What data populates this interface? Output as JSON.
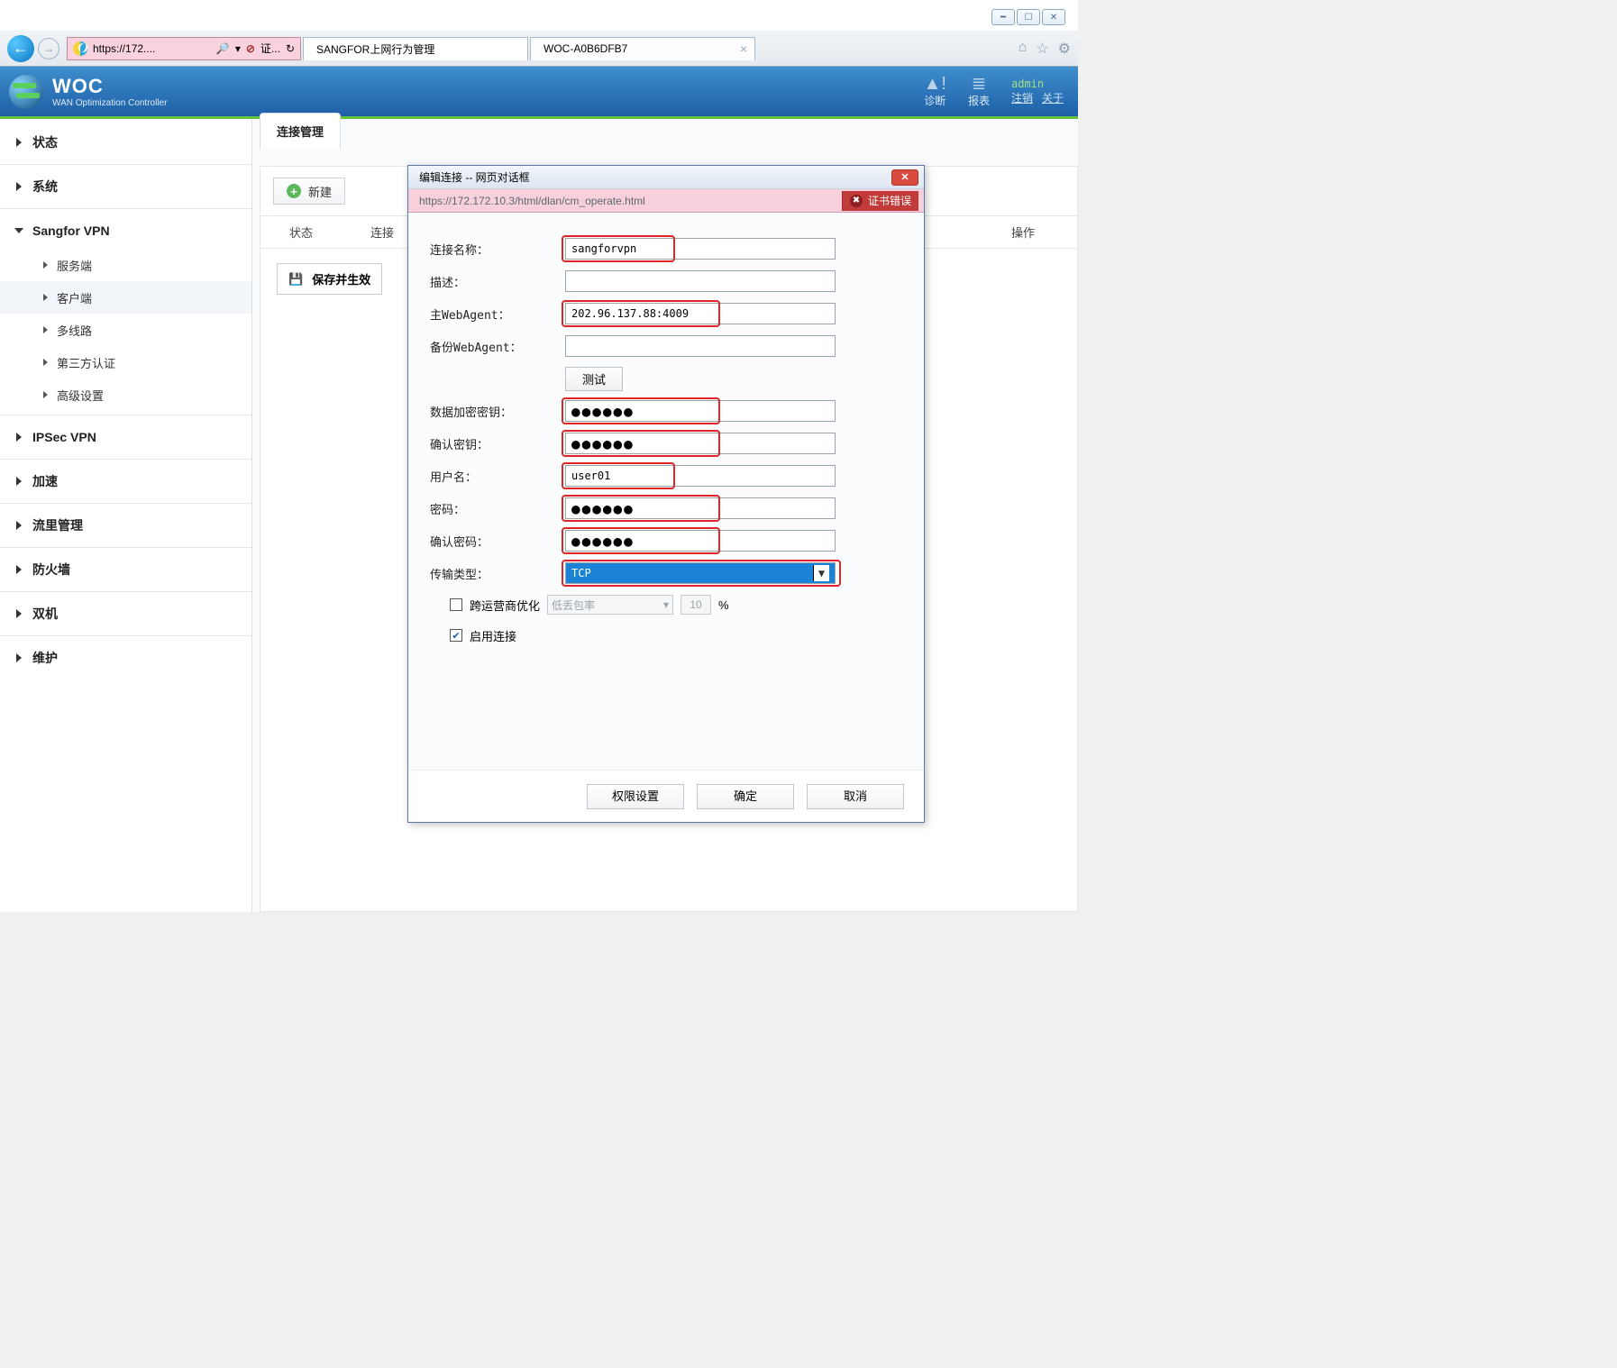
{
  "window": {
    "min_tooltip": "Minimize",
    "max_tooltip": "Maximize",
    "close_tooltip": "Close"
  },
  "ie": {
    "address_display": "https://172....",
    "search_symbol": "🔎",
    "cert_short": "证...",
    "tabs": [
      {
        "title": "SANGFOR上网行为管理",
        "active": false
      },
      {
        "title": "WOC-A0B6DFB7",
        "active": true
      }
    ]
  },
  "app": {
    "title": "WOC",
    "subtitle": "WAN Optimization Controller",
    "actions": {
      "diag": "诊断",
      "reports": "报表"
    },
    "admin": {
      "user": "admin",
      "logout": "注销",
      "about": "关于"
    }
  },
  "sidebar": {
    "items": [
      {
        "label": "状态"
      },
      {
        "label": "系统"
      },
      {
        "label": "Sangfor VPN",
        "expanded": true,
        "children": [
          {
            "label": "服务端"
          },
          {
            "label": "客户端",
            "selected": true
          },
          {
            "label": "多线路"
          },
          {
            "label": "第三方认证"
          },
          {
            "label": "高级设置"
          }
        ]
      },
      {
        "label": "IPSec VPN"
      },
      {
        "label": "加速"
      },
      {
        "label": "流里管理"
      },
      {
        "label": "防火墙"
      },
      {
        "label": "双机"
      },
      {
        "label": "维护"
      }
    ]
  },
  "tab": {
    "label": "连接管理"
  },
  "toolbar": {
    "new_label": "新建",
    "save_label": "保存并生效"
  },
  "columns": {
    "status": "状态",
    "conn": "连接",
    "ops": "操作"
  },
  "dialog": {
    "title": "编辑连接 -- 网页对话框",
    "url": "https://172.172.10.3/html/dlan/cm_operate.html",
    "cert_error": "证书错误",
    "labels": {
      "conn_name": "连接名称：",
      "desc": "描述：",
      "main_wa": "主WebAgent：",
      "bak_wa": "备份WebAgent：",
      "encrypt_key": "数据加密密钥：",
      "confirm_key": "确认密钥：",
      "username": "用户名：",
      "password": "密码：",
      "confirm_pw": "确认密码：",
      "trans_type": "传输类型：",
      "cross_isp": "跨运营商优化",
      "loss_rate": "低丢包率",
      "enable_conn": "启用连接",
      "percent": "%"
    },
    "values": {
      "conn_name": "sangforvpn",
      "desc": "",
      "main_wa": "202.96.137.88:4009",
      "bak_wa": "",
      "encrypt_key": "●●●●●●",
      "confirm_key": "●●●●●●",
      "username": "user01",
      "password": "●●●●●●",
      "confirm_pw": "●●●●●●",
      "trans_type": "TCP",
      "loss_pct": "10",
      "cross_isp_checked": false,
      "enable_checked": true
    },
    "buttons": {
      "test": "测试",
      "perm": "权限设置",
      "ok": "确定",
      "cancel": "取消"
    }
  }
}
